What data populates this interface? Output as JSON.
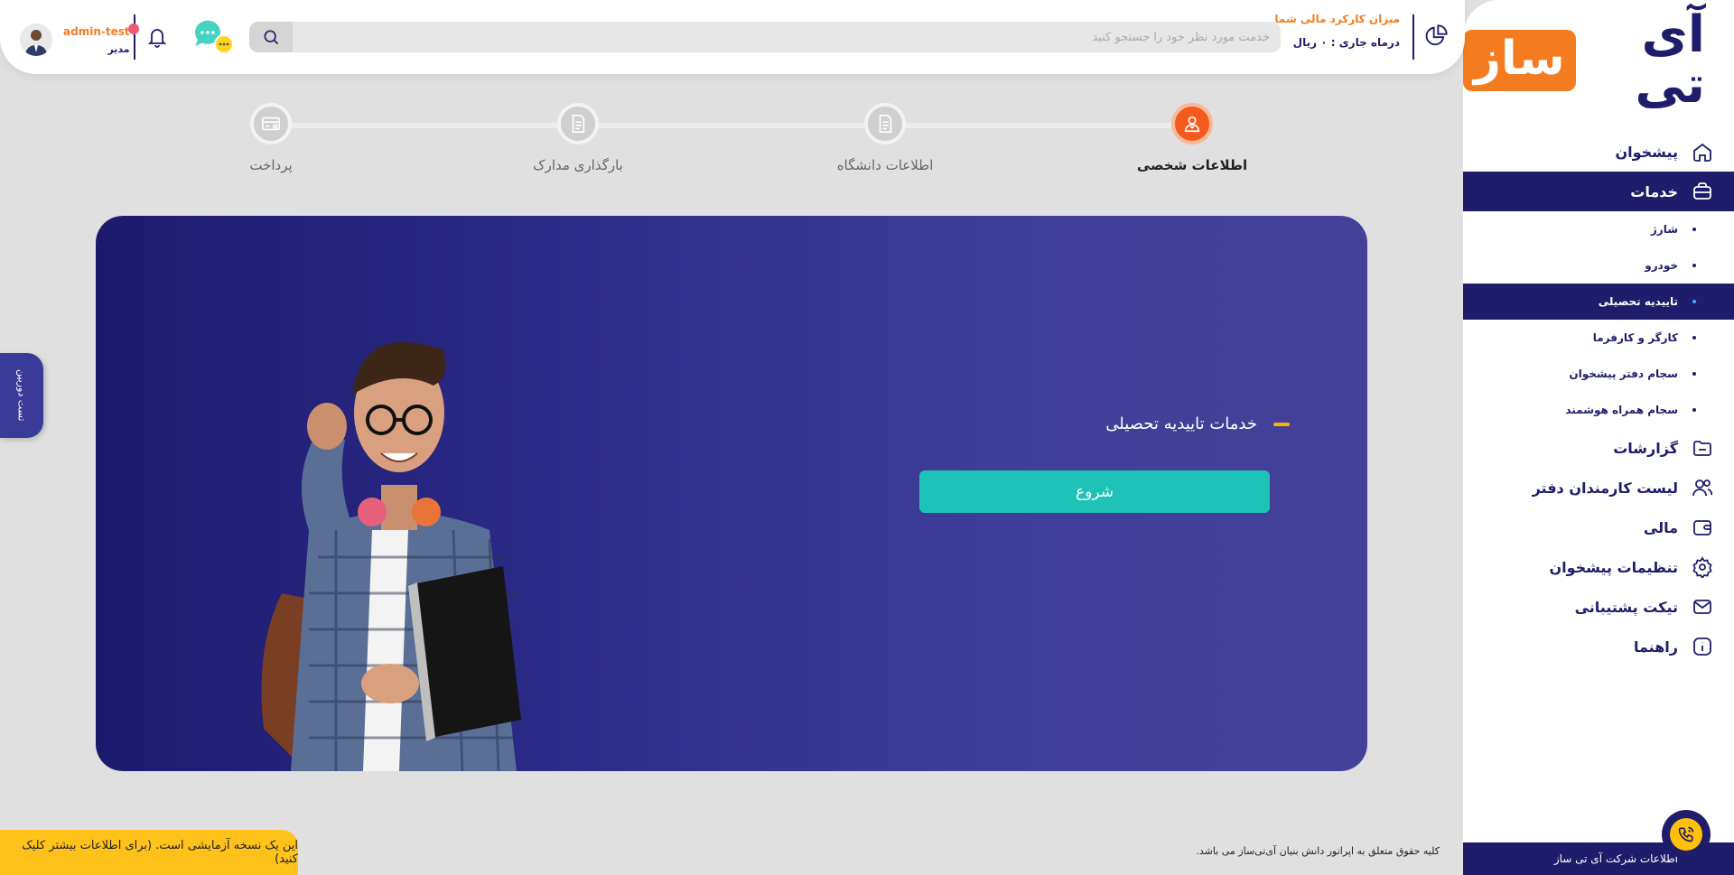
{
  "sidebar": {
    "logo_main": "آی تی",
    "logo_accent": "ساز",
    "items": [
      {
        "label": "پیشخوان",
        "icon": "home-icon"
      },
      {
        "label": "خدمات",
        "icon": "briefcase-icon"
      },
      {
        "label": "گزارشات",
        "icon": "folder-icon"
      },
      {
        "label": "لیست کارمندان دفتر",
        "icon": "users-icon"
      },
      {
        "label": "مالی",
        "icon": "wallet-icon"
      },
      {
        "label": "تنظیمات پیشخوان",
        "icon": "gear-icon"
      },
      {
        "label": "تیکت پشتیبانی",
        "icon": "mail-icon"
      },
      {
        "label": "راهنما",
        "icon": "info-icon"
      }
    ],
    "sub_items": [
      {
        "label": "شارژ"
      },
      {
        "label": "خودرو"
      },
      {
        "label": "تاییدیه تحصیلی"
      },
      {
        "label": "کارگر و کارفرما"
      },
      {
        "label": "سجام دفتر پیشخوان"
      },
      {
        "label": "سجام همراه هوشمند"
      }
    ],
    "footer": "اطلاعات شرکت آی تی ساز"
  },
  "header": {
    "financial_title": "میزان کارکرد مالی شما",
    "financial_value": "درماه جاری : ۰ ریال",
    "search_placeholder": "خدمت مورد نظر خود را جستجو کنید",
    "username": "admin-test",
    "role": "مدیر"
  },
  "stepper": {
    "steps": [
      {
        "label": "اطلاعات شخصی",
        "active": true,
        "icon": "user-icon"
      },
      {
        "label": "اطلاعات دانشگاه",
        "active": false,
        "icon": "document-icon"
      },
      {
        "label": "بارگذاری مدارک",
        "active": false,
        "icon": "document-icon"
      },
      {
        "label": "پرداخت",
        "active": false,
        "icon": "card-icon"
      }
    ]
  },
  "banner": {
    "title": "خدمات تاییدیه تحصیلی",
    "start_button": "شروع"
  },
  "side_tab": "تست دوربین",
  "footer": {
    "copyright": "کلیه حقوق متعلق به اپراتور دانش بنیان آی‌تی‌ساز می باشد.",
    "trial_notice": "این یک نسخه آزمایشی است. (برای اطلاعات بیشتر کلیک کنید)"
  },
  "colors": {
    "primary": "#1f1d6b",
    "accent_orange": "#f47c20",
    "teal": "#1cc3b6",
    "yellow": "#ffc21a"
  }
}
